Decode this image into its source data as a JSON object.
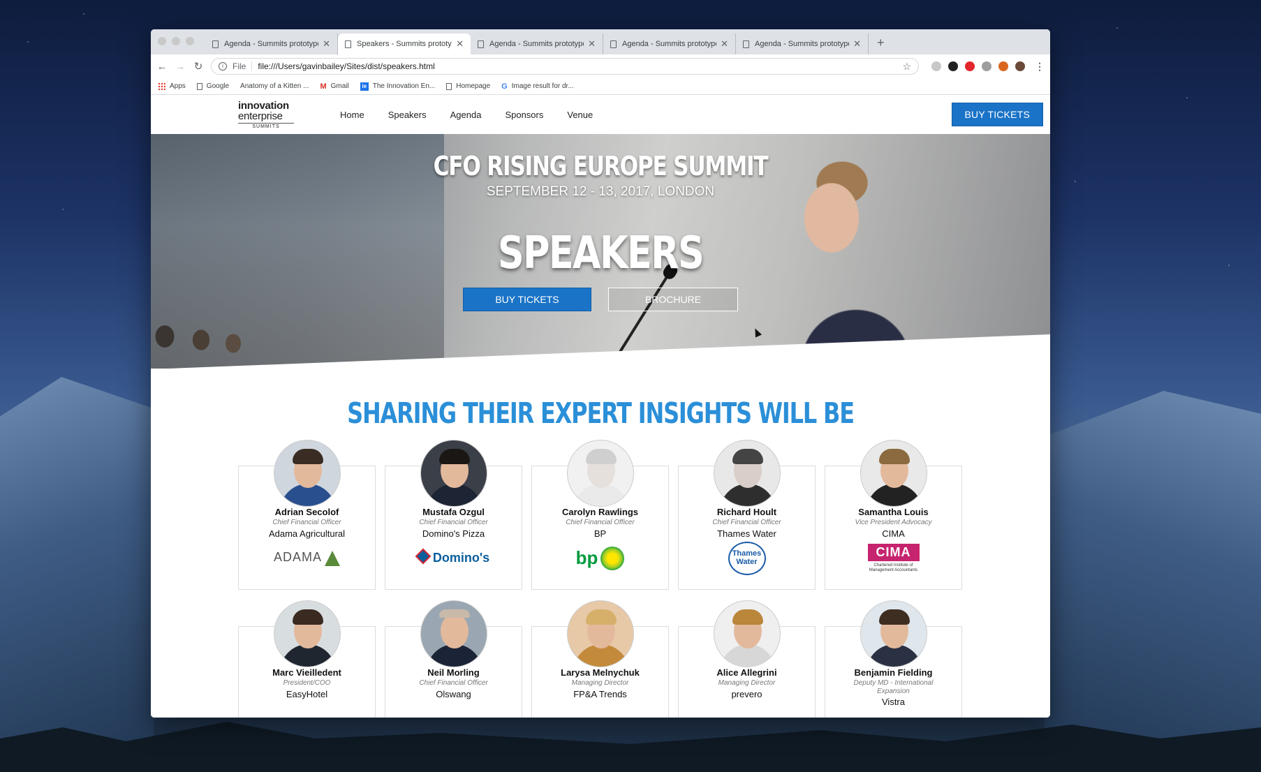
{
  "browser": {
    "tabs": [
      {
        "title": "Agenda - Summits prototype",
        "active": false
      },
      {
        "title": "Speakers - Summits prototype",
        "active": true
      },
      {
        "title": "Agenda - Summits prototype",
        "active": false
      },
      {
        "title": "Agenda - Summits prototype",
        "active": false
      },
      {
        "title": "Agenda - Summits prototype",
        "active": false
      }
    ],
    "new_tab": "+",
    "omnibox": {
      "scheme": "File",
      "url": "file:///Users/gavinbailey/Sites/dist/speakers.html"
    },
    "bookmarks": [
      {
        "label": "Apps",
        "icon": "apps-icon"
      },
      {
        "label": "Google",
        "icon": "document-icon"
      },
      {
        "label": "Anatomy of a Kitten ...",
        "icon": "none"
      },
      {
        "label": "Gmail",
        "icon": "gmail-icon"
      },
      {
        "label": "The Innovation En...",
        "icon": "ie-icon"
      },
      {
        "label": "Homepage",
        "icon": "document-icon"
      },
      {
        "label": "Image result for dr...",
        "icon": "google-icon"
      }
    ]
  },
  "site": {
    "logo": {
      "line1": "innovation",
      "line2": "enterprise",
      "line3": "SUMMITS"
    },
    "nav": [
      "Home",
      "Speakers",
      "Agenda",
      "Sponsors",
      "Venue"
    ],
    "header_cta": "BUY TICKETS",
    "hero": {
      "event_title": "CFO RISING EUROPE SUMMIT",
      "event_date": "SEPTEMBER 12 - 13, 2017, LONDON",
      "heading": "SPEAKERS",
      "primary_button": "BUY TICKETS",
      "secondary_button": "BROCHURE"
    },
    "section_heading": "SHARING THEIR EXPERT INSIGHTS WILL BE",
    "speakers": [
      {
        "name": "Adrian Secolof",
        "role": "Chief Financial Officer",
        "company": "Adama Agricultural",
        "logo_text": "ADAMA"
      },
      {
        "name": "Mustafa Ozgul",
        "role": "Chief Financial Officer",
        "company": "Domino's Pizza",
        "logo_text": "Domino's"
      },
      {
        "name": "Carolyn Rawlings",
        "role": "Chief Financial Officer",
        "company": "BP",
        "logo_text": "bp"
      },
      {
        "name": "Richard Hoult",
        "role": "Chief Financial Officer",
        "company": "Thames Water",
        "logo_text": "Thames Water"
      },
      {
        "name": "Samantha Louis",
        "role": "Vice President Advocacy",
        "company": "CIMA",
        "logo_text": "CIMA",
        "logo_sub": "Chartered Institute of Management Accountants"
      },
      {
        "name": "Marc Vieilledent",
        "role": "President/COO",
        "company": "EasyHotel"
      },
      {
        "name": "Neil Morling",
        "role": "Chief Financial Officer",
        "company": "Olswang"
      },
      {
        "name": "Larysa Melnychuk",
        "role": "Managing Director",
        "company": "FP&A Trends"
      },
      {
        "name": "Alice Allegrini",
        "role": "Managing Director",
        "company": "prevero"
      },
      {
        "name": "Benjamin Fielding",
        "role": "Deputy MD - International Expansion",
        "company": "Vistra"
      }
    ]
  }
}
